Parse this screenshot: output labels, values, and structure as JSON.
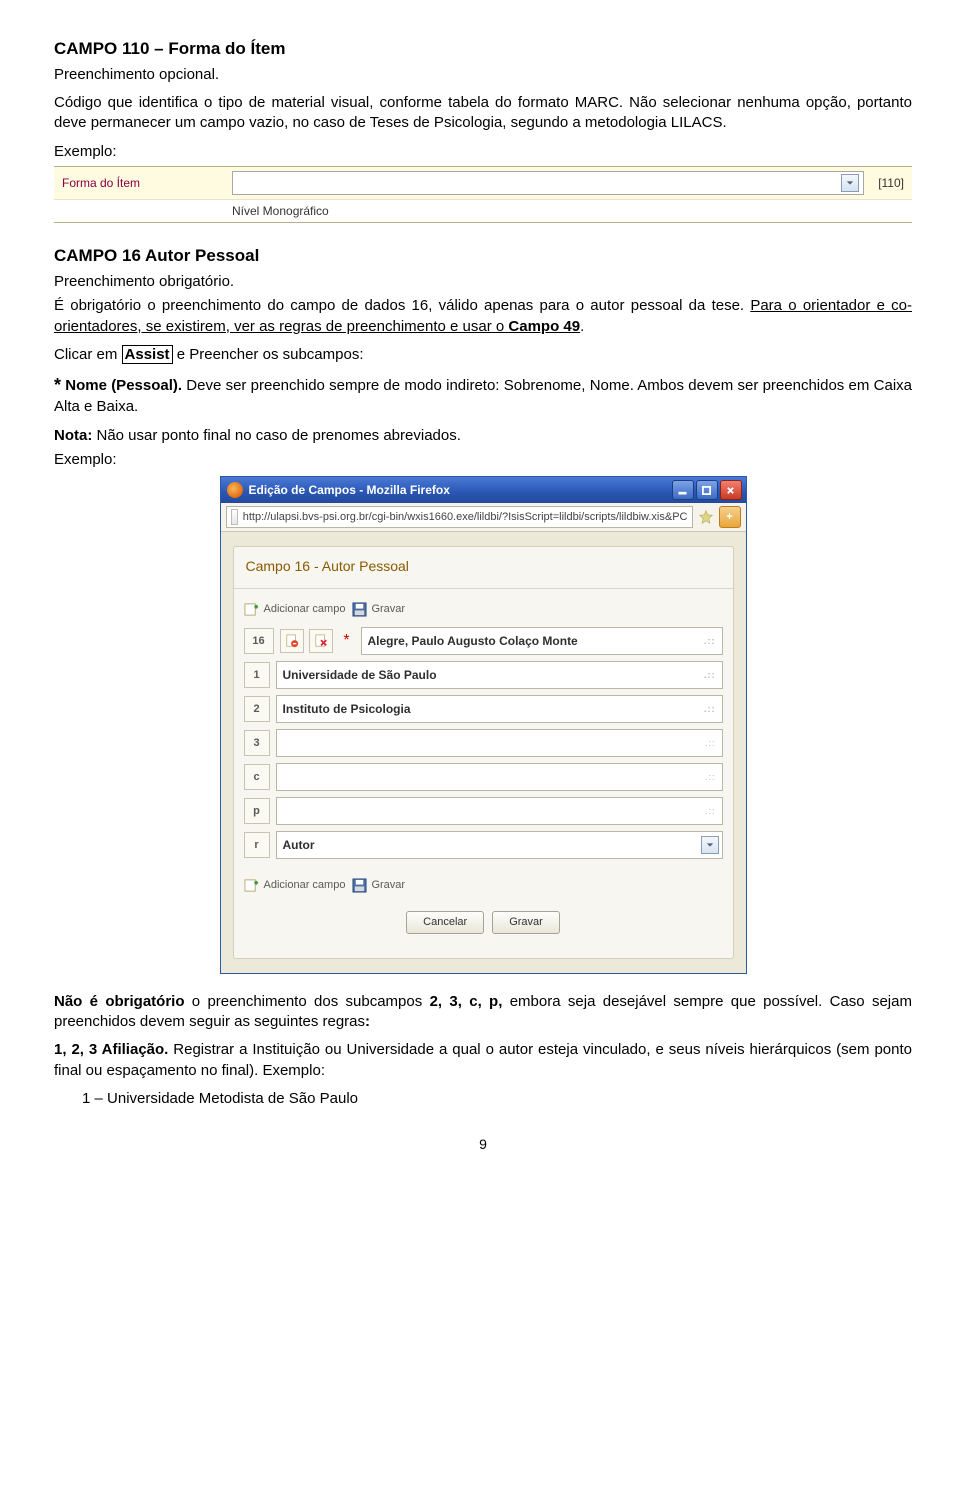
{
  "section110": {
    "title": "CAMPO 110 – Forma do Ítem",
    "line1": "Preenchimento opcional.",
    "line2": "Código que identifica o tipo de material visual, conforme tabela do formato MARC. Não selecionar nenhuma opção, portanto deve permanecer um campo vazio, no caso de Teses de Psicologia, segundo a metodologia LILACS.",
    "exemplo": "Exemplo:"
  },
  "form110": {
    "label": "Forma do Ítem",
    "code": "[110]",
    "sublabel": "Nível Monográfico"
  },
  "section16": {
    "title": "CAMPO 16 Autor Pessoal",
    "line1": "Preenchimento obrigatório.",
    "para2a": "É obrigatório o preenchimento do campo de dados 16, válido apenas para o autor pessoal da tese. ",
    "para2b_u": "Para o orientador e co-orientadores, se existirem, ver as regras de preenchimento e usar o ",
    "para2c_bold": "Campo 49",
    "para2d": ".",
    "clicar_pre": "Clicar em ",
    "assist": "Assist",
    "clicar_post": " e Preencher os subcampos:",
    "nome_label": "Nome (Pessoal).",
    "nome_rest": " Deve ser preenchido sempre de modo indireto: Sobrenome, Nome. Ambos devem ser preenchidos em Caixa Alta e Baixa.",
    "nota_label": "Nota:",
    "nota_rest": " Não usar ponto final no caso de prenomes abreviados.",
    "exemplo": "Exemplo:"
  },
  "popup": {
    "window_title": "Edição de Campos - Mozilla Firefox",
    "url": "http://ulapsi.bvs-psi.org.br/cgi-bin/wxis1660.exe/lildbi/?IsisScript=lildbi/scripts/lildbiw.xis&PC",
    "panel_title": "Campo 16 - Autor Pessoal",
    "add_field": "Adicionar campo",
    "save": "Gravar",
    "cancel": "Cancelar",
    "fields": {
      "main_id": "16",
      "main_value": "Alegre, Paulo Augusto Colaço Monte",
      "f1_id": "1",
      "f1_value": "Universidade de São Paulo",
      "f2_id": "2",
      "f2_value": "Instituto de Psicologia",
      "f3_id": "3",
      "f3_value": "",
      "fc_id": "c",
      "fc_value": "",
      "fp_id": "p",
      "fp_value": "",
      "fr_id": "r",
      "fr_value": "Autor"
    }
  },
  "footer": {
    "para1a": "Não é obrigatório",
    "para1b": " o preenchimento dos subcampos ",
    "para1c": "2, 3, c, p,",
    "para1d": " embora seja desejável sempre que possível. Caso sejam preenchidos devem seguir as seguintes regras",
    "para1e": ":",
    "afil_label": "1, 2, 3 Afiliação.",
    "afil_rest": " Registrar a Instituição ou Universidade a qual o autor esteja vinculado, e seus níveis hierárquicos (sem ponto final ou espaçamento no final). Exemplo:",
    "afil_ex": "1 – Universidade Metodista de São Paulo"
  },
  "page_number": "9"
}
